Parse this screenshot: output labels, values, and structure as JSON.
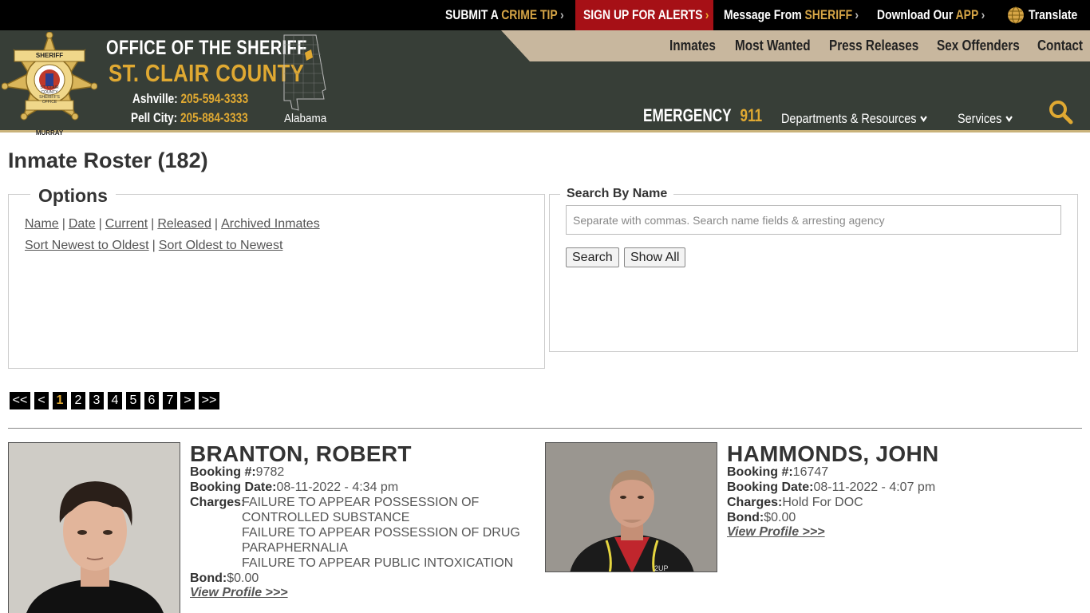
{
  "topbar": {
    "crime_tip": {
      "pre": "SUBMIT A ",
      "highlight": "CRIME TIP"
    },
    "alerts": "SIGN UP FOR ALERTS",
    "message": {
      "pre": "Message From ",
      "highlight": "SHERIFF"
    },
    "download": {
      "pre": "Download Our ",
      "highlight": "APP"
    },
    "translate": "Translate",
    "chevron": "›"
  },
  "header": {
    "title_line1": "OFFICE OF THE SHERIFF",
    "title_line2": "ST. CLAIR COUNTY",
    "phones": [
      {
        "label": "Ashville:",
        "number": "205-594-3333"
      },
      {
        "label": "Pell City:",
        "number": "205-884-3333"
      }
    ],
    "badge_text": {
      "top": "SHERIFF",
      "ring": "ST. CLAIR COUNTY",
      "ring2": "SHERIFF'S OFFICE",
      "bottom": "MURRAY"
    },
    "state_label": "Alabama",
    "emergency_label": "EMERGENCY",
    "emergency_number": "911",
    "nav_top": [
      "Inmates",
      "Most Wanted",
      "Press Releases",
      "Sex Offenders",
      "Contact"
    ],
    "nav_low": {
      "departments": "Departments & Resources",
      "services": "Services"
    },
    "chevron_down": "⌄"
  },
  "colors": {
    "gold": "#e0a932",
    "header_bg": "#373e37",
    "alert_red": "#a61016",
    "tan": "#c8b79e"
  },
  "main": {
    "title": "Inmate Roster (182)",
    "options": {
      "legend": "Options",
      "row1": [
        "Name",
        "Date",
        "Current",
        "Released",
        "Archived Inmates"
      ],
      "row2": [
        "Sort Newest to Oldest",
        "Sort Oldest to Newest"
      ],
      "separator": "|"
    },
    "search": {
      "legend": "Search By Name",
      "placeholder": "Separate with commas. Search name fields & arresting agency",
      "search_button": "Search",
      "show_all_button": "Show All"
    },
    "pagination": {
      "first": "<<",
      "prev": "<",
      "pages": [
        "1",
        "2",
        "3",
        "4",
        "5",
        "6",
        "7"
      ],
      "current": "1",
      "next": ">",
      "last": ">>"
    },
    "inmates": [
      {
        "name": "BRANTON, ROBERT",
        "booking_no_label": "Booking #:",
        "booking_no": "9782",
        "booking_date_label": "Booking Date:",
        "booking_date": "08-11-2022 - 4:34 pm",
        "charges_label": "Charges:",
        "charges": [
          "FAILURE TO APPEAR POSSESSION OF",
          "CONTROLLED SUBSTANCE",
          "FAILURE TO APPEAR POSSESSION OF DRUG",
          "PARAPHERNALIA",
          "FAILURE TO APPEAR PUBLIC INTOXICATION"
        ],
        "bond_label": "Bond:",
        "bond": "$0.00",
        "view_profile": "View Profile >>>"
      },
      {
        "name": "HAMMONDS, JOHN",
        "booking_no_label": "Booking #:",
        "booking_no": "16747",
        "booking_date_label": "Booking Date:",
        "booking_date": "08-11-2022 - 4:07 pm",
        "charges_label": "Charges:",
        "charges": [
          "Hold For DOC"
        ],
        "bond_label": "Bond:",
        "bond": "$0.00",
        "view_profile": "View Profile >>>",
        "shirt_text": "2UP"
      }
    ]
  }
}
